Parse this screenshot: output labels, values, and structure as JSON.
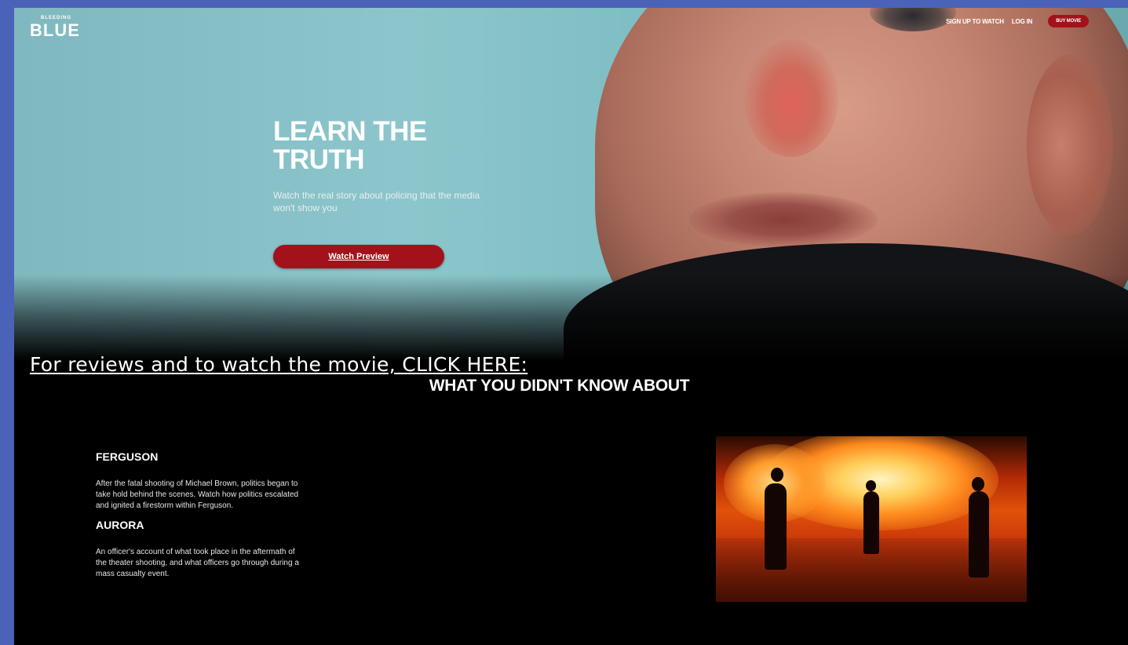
{
  "brand": {
    "logo_small": "BLEEDING",
    "logo_big": "BLUE"
  },
  "nav": {
    "signup": "SIGN UP TO WATCH",
    "login": "LOG IN",
    "buy": "BUY MOVIE"
  },
  "hero": {
    "title": "LEARN THE TRUTH",
    "subtitle": "Watch the real story about policing that the media won't show you",
    "cta": "Watch Preview"
  },
  "review_link": "For reviews and to watch the movie, CLICK HERE:",
  "section_title": "WHAT YOU DIDN'T KNOW ABOUT",
  "topics": [
    {
      "title": "FERGUSON",
      "body": "After the fatal shooting of Michael Brown, politics began to take hold behind the scenes. Watch how politics escalated and ignited a firestorm within Ferguson."
    },
    {
      "title": "AURORA",
      "body": "An officer's account of what took place in the aftermath of the theater shooting, and what officers go through during a mass casualty event."
    }
  ],
  "colors": {
    "accent": "#a3121b",
    "page_border": "#4a63b8",
    "background": "#000000"
  }
}
